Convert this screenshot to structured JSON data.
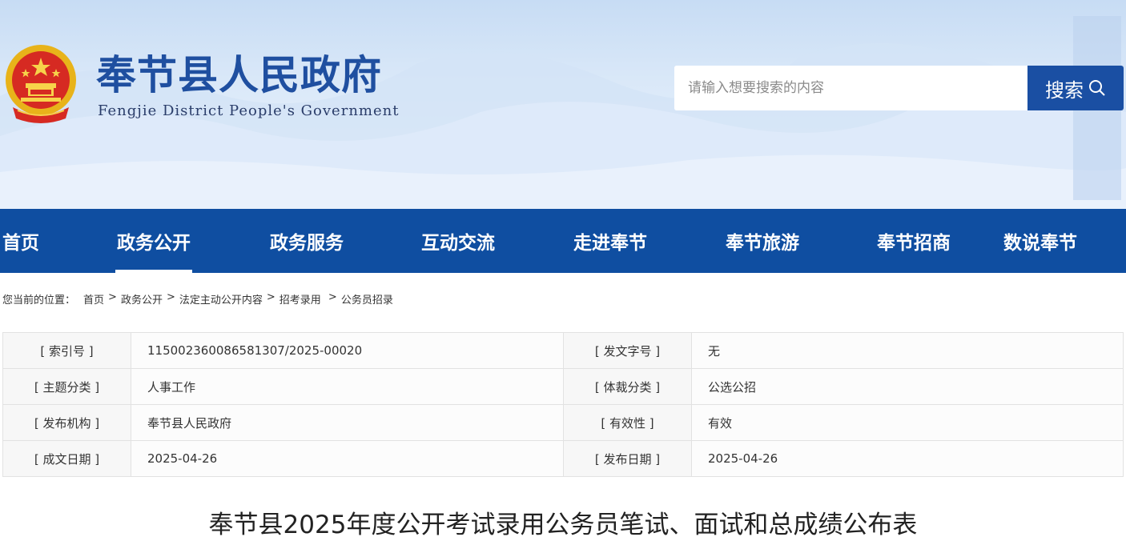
{
  "header": {
    "title": "奉节县人民政府",
    "subtitle": "Fengjie District People's Government"
  },
  "search": {
    "placeholder": "请输入想要搜索的内容",
    "button_label": "搜索"
  },
  "nav": {
    "items": [
      {
        "label": "首页"
      },
      {
        "label": "政务公开",
        "active": true
      },
      {
        "label": "政务服务"
      },
      {
        "label": "互动交流"
      },
      {
        "label": "走进奉节"
      },
      {
        "label": "奉节旅游"
      },
      {
        "label": "奉节招商"
      },
      {
        "label": "数说奉节"
      }
    ]
  },
  "breadcrumb": {
    "prefix": "您当前的位置：",
    "items": [
      "首页",
      "政务公开",
      "法定主动公开内容",
      "招考录用",
      "公务员招录"
    ]
  },
  "info": {
    "rows": [
      {
        "l1": "[ 索引号 ]",
        "v1": "11500236008658130​7/2025-00020",
        "l2": "[ 发文字号 ]",
        "v2": "无"
      },
      {
        "l1": "[ 主题分类 ]",
        "v1": "人事工作",
        "l2": "[ 体裁分类 ]",
        "v2": "公选公招"
      },
      {
        "l1": "[ 发布机构 ]",
        "v1": "奉节县人民政府",
        "l2": "[ 有效性 ]",
        "v2": "有效"
      },
      {
        "l1": "[ 成文日期 ]",
        "v1": "2025-04-26",
        "l2": "[ 发布日期 ]",
        "v2": "2025-04-26"
      }
    ]
  },
  "article": {
    "title": "奉节县2025年度公开考试录用公务员笔试、面试和总成绩公布表"
  },
  "colors": {
    "brand": "#1f4fa0",
    "nav_bg": "#0f4ea1",
    "search_btn": "#1a4fa3"
  }
}
